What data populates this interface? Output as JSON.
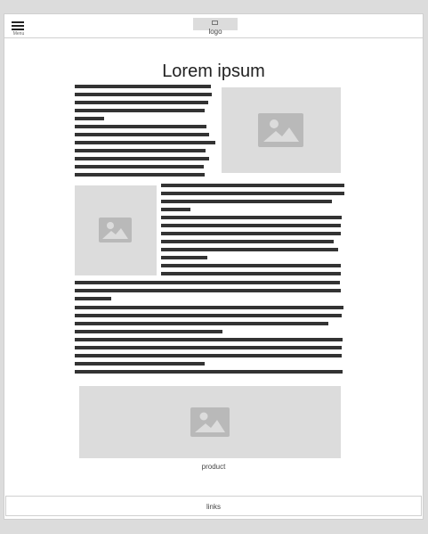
{
  "header": {
    "menu_label": "Menu",
    "logo_label": "logo"
  },
  "main": {
    "title": "Lorem ipsum"
  },
  "product": {
    "caption": "product"
  },
  "footer": {
    "links_label": "links"
  },
  "icons": {
    "image_placeholder": "image-icon",
    "menu": "hamburger-icon"
  },
  "colors": {
    "placeholder_bg": "#dcdcdc",
    "text_line": "#333333"
  }
}
